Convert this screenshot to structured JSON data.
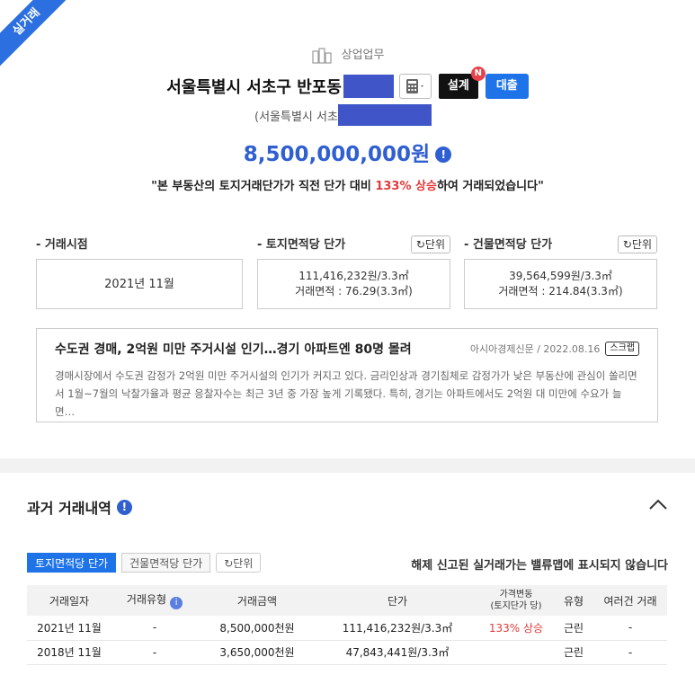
{
  "ribbon": "실거래",
  "category": "상업업무",
  "address": {
    "main": "서울특별시 서초구 반포동",
    "sub": "(서울특별시 서초"
  },
  "buttons": {
    "design": "설계",
    "design_badge": "N",
    "loan": "대출"
  },
  "price": "8,500,000,000원",
  "message": {
    "prefix": "\"본 부동산의 토지거래단가가 직전 단가 대비 ",
    "highlight": "133% 상승",
    "suffix": "하여 거래되었습니다\""
  },
  "metrics": {
    "date": {
      "label": "- 거래시점",
      "value": "2021년 11월"
    },
    "land": {
      "label": "- 토지면적당 단가",
      "unit_btn": "단위",
      "line1": "111,416,232원/3.3㎡",
      "line2": "거래면적 : 76.29(3.3㎡)"
    },
    "building": {
      "label": "- 건물면적당 단가",
      "unit_btn": "단위",
      "line1": "39,564,599원/3.3㎡",
      "line2": "거래면적 : 214.84(3.3㎡)"
    }
  },
  "news": {
    "title": "수도권 경매, 2억원 미만 주거시설 인기…경기 아파트엔 80명 몰려",
    "source": "아시아경제신문 / 2022.08.16",
    "scrap": "스크랩",
    "body_line1": "경매시장에서 수도권 감정가 2억원 미만 주거시설의 인기가 커지고 있다. 금리인상과 경기침체로 감정가가 낮은 부동산에 관심이 쏠리면",
    "body_line2": "서 1월~7월의 낙찰가율과 평균 응찰자수는 최근 3년 중 가장 높게 기록됐다. 특히, 경기는 아파트에서도 2억원 대 미만에 수요가 늘면…"
  },
  "history": {
    "title": "과거 거래내역",
    "tabs": [
      "토지면적당 단가",
      "건물면적당 단가"
    ],
    "unit_btn": "단위",
    "notice": "해제 신고된 실거래가는 밸류맵에 표시되지 않습니다",
    "columns": {
      "date": "거래일자",
      "type": "거래유형",
      "amount": "거래금액",
      "unit_price": "단가",
      "change_line1": "가격변동",
      "change_line2": "(토지단가 당)",
      "kind": "유형",
      "multi": "여러건 거래"
    },
    "rows": [
      {
        "date": "2021년 11월",
        "type": "-",
        "amount": "8,500,000천원",
        "unit_price": "111,416,232원/3.3㎡",
        "change": "133% 상승",
        "kind": "근린",
        "multi": "-"
      },
      {
        "date": "2018년 11월",
        "type": "-",
        "amount": "3,650,000천원",
        "unit_price": "47,843,441원/3.3㎡",
        "change": "",
        "kind": "근린",
        "multi": "-"
      }
    ]
  }
}
